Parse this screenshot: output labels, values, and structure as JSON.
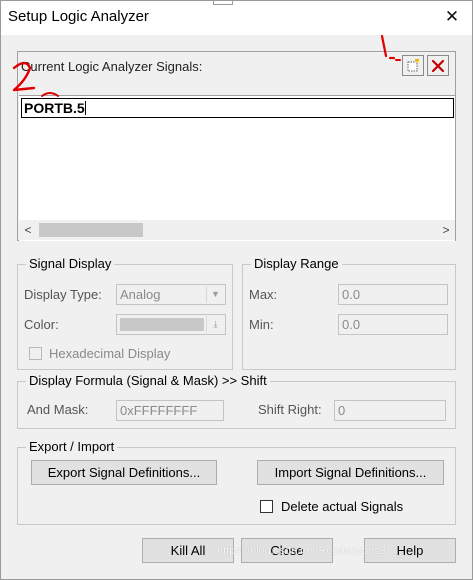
{
  "window": {
    "title": "Setup Logic Analyzer",
    "close_glyph": "✕"
  },
  "signals": {
    "label": "Current Logic Analyzer Signals:",
    "new_icon": "new-signal-icon",
    "delete_icon": "delete-signal-icon",
    "editing_value": "PORTB.5",
    "scroll_left": "<",
    "scroll_right": ">"
  },
  "signal_display": {
    "title": "Signal Display",
    "display_type_label": "Display Type:",
    "display_type_value": "Analog",
    "color_label": "Color:",
    "color_value": "#c8c8c8",
    "hex_label": "Hexadecimal Display"
  },
  "display_range": {
    "title": "Display Range",
    "max_label": "Max:",
    "max_value": "0.0",
    "min_label": "Min:",
    "min_value": "0.0"
  },
  "formula": {
    "title": "Display Formula (Signal & Mask) >> Shift",
    "and_mask_label": "And Mask:",
    "and_mask_value": "0xFFFFFFFF",
    "shift_right_label": "Shift Right:",
    "shift_right_value": "0"
  },
  "export_import": {
    "title": "Export / Import",
    "export_label": "Export Signal Definitions...",
    "import_label": "Import Signal Definitions...",
    "delete_actual_label": "Delete actual Signals"
  },
  "buttons": {
    "kill_all": "Kill All",
    "close": "Close",
    "help": "Help"
  },
  "annotations": {
    "one": "1.",
    "two": "2",
    "color": "#e00000"
  },
  "watermark": "https://blog.csdn.net/Rendezvous3"
}
